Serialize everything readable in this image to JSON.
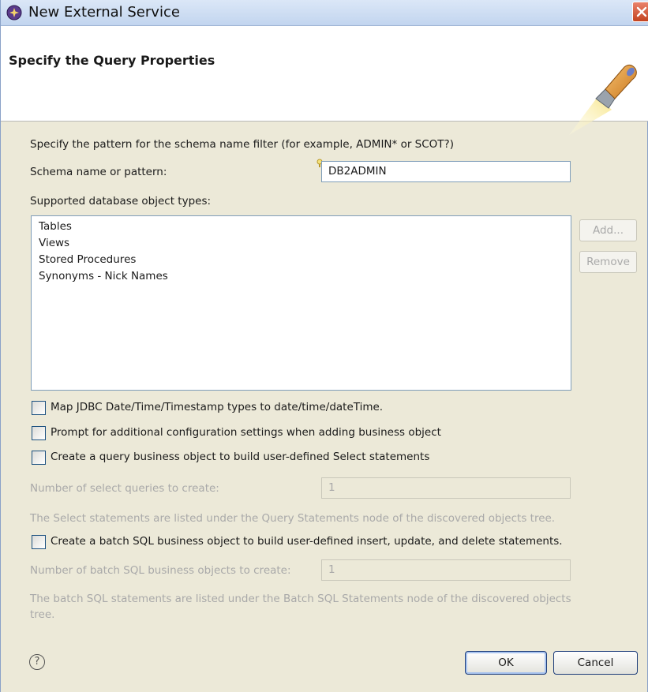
{
  "window": {
    "title": "New External Service"
  },
  "banner": {
    "title": "Specify the Query Properties",
    "icon": "flashlight-icon"
  },
  "form": {
    "intro": "Specify the pattern for the schema name filter (for example, ADMIN* or SCOT?)",
    "schema_label": "Schema name or pattern:",
    "schema_value": "DB2ADMIN",
    "types_label": "Supported database object types:",
    "types": [
      "Tables",
      "Views",
      "Stored Procedures",
      "Synonyms - Nick Names"
    ],
    "add_label": "Add...",
    "remove_label": "Remove",
    "map_jdbc_label": "Map JDBC Date/Time/Timestamp types to date/time/dateTime.",
    "prompt_label": "Prompt for additional configuration settings when adding business object",
    "query_bo_label": "Create a query business object to build user-defined Select statements",
    "num_select_label": "Number of select queries to create:",
    "num_select_value": "1",
    "select_note": "The Select statements are listed under the Query Statements node of the discovered objects tree.",
    "batch_bo_label": "Create a batch SQL business object to build user-defined insert, update, and delete statements.",
    "num_batch_label": "Number of batch SQL business objects to create:",
    "num_batch_value": "1",
    "batch_note_line1": "The batch SQL statements are listed under the Batch SQL Statements node of the discovered objects",
    "batch_note_line2": "tree."
  },
  "footer": {
    "help_glyph": "?",
    "ok_label": "OK",
    "cancel_label": "Cancel"
  }
}
